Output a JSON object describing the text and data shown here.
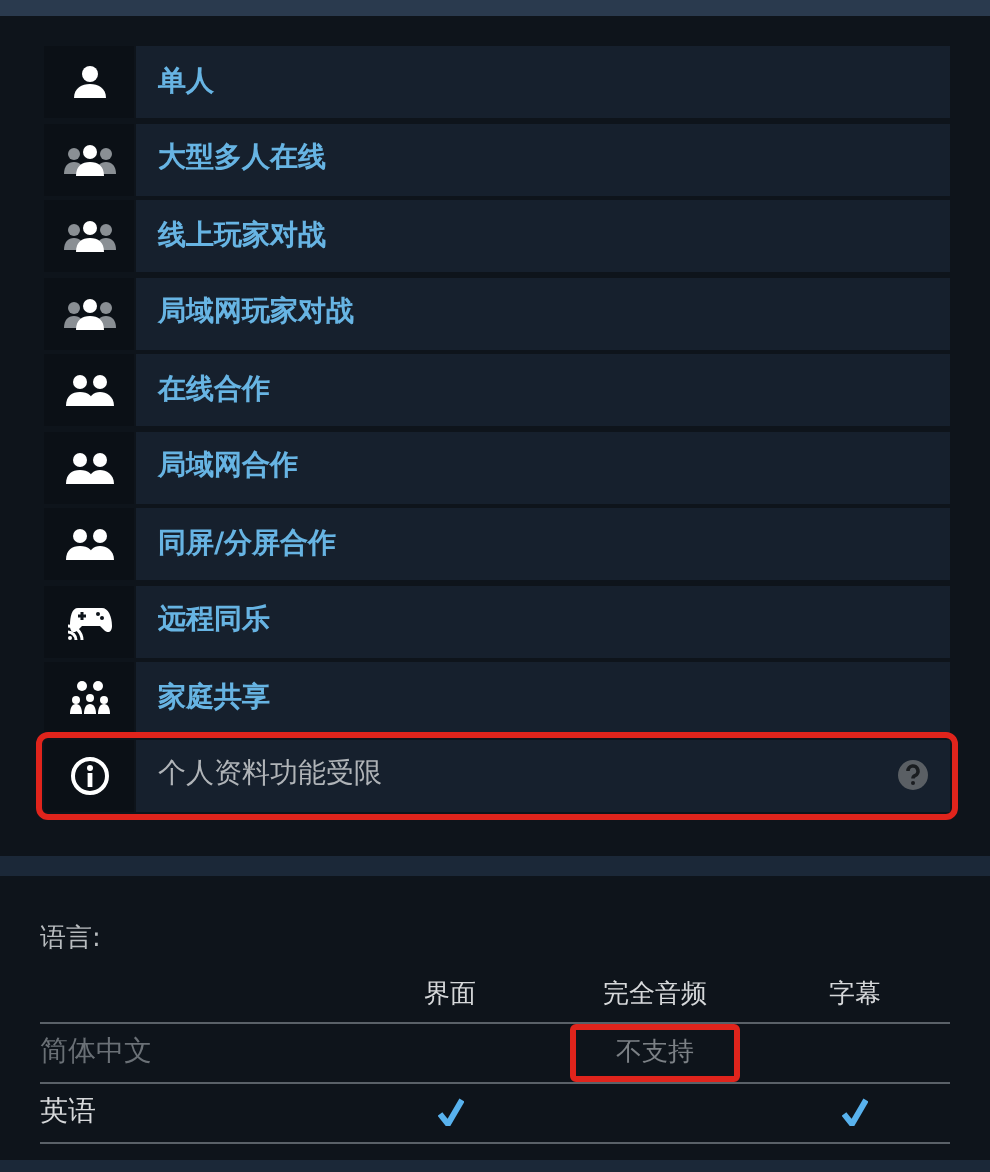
{
  "features": [
    {
      "label": "单人",
      "kind": "single",
      "restricted": false,
      "highlighted": false
    },
    {
      "label": "大型多人在线",
      "kind": "crowd",
      "restricted": false,
      "highlighted": false
    },
    {
      "label": "线上玩家对战",
      "kind": "crowd",
      "restricted": false,
      "highlighted": false
    },
    {
      "label": "局域网玩家对战",
      "kind": "crowd",
      "restricted": false,
      "highlighted": false
    },
    {
      "label": "在线合作",
      "kind": "pair",
      "restricted": false,
      "highlighted": false
    },
    {
      "label": "局域网合作",
      "kind": "pair",
      "restricted": false,
      "highlighted": false
    },
    {
      "label": "同屏/分屏合作",
      "kind": "pair",
      "restricted": false,
      "highlighted": false
    },
    {
      "label": "远程同乐",
      "kind": "remote",
      "restricted": false,
      "highlighted": false
    },
    {
      "label": "家庭共享",
      "kind": "family",
      "restricted": false,
      "highlighted": false
    },
    {
      "label": "个人资料功能受限",
      "kind": "info",
      "restricted": true,
      "highlighted": true
    }
  ],
  "languages": {
    "label": "语言:",
    "columns": [
      "界面",
      "完全音频",
      "字幕"
    ],
    "rows": [
      {
        "name": "简体中文",
        "supported": false,
        "cells": [
          {
            "kind": "check",
            "checked": false
          },
          {
            "kind": "text",
            "text": "不支持",
            "highlighted": true
          },
          {
            "kind": "check",
            "checked": false
          }
        ]
      },
      {
        "name": "英语",
        "supported": true,
        "cells": [
          {
            "kind": "check",
            "checked": true
          },
          {
            "kind": "check",
            "checked": false
          },
          {
            "kind": "check",
            "checked": true
          }
        ]
      }
    ]
  }
}
